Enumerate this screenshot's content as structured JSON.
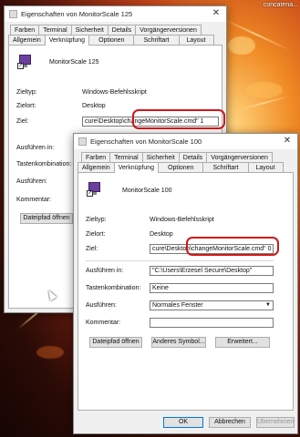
{
  "background": {
    "corner_text": "concatena..."
  },
  "win125": {
    "title": "Eigenschaften von MonitorScale 125",
    "tabs_row1": [
      "Farben",
      "Terminal",
      "Sicherheit",
      "Details",
      "Vorgängerversionen"
    ],
    "tabs_row2": [
      "Allgemein",
      "Verknüpfung",
      "Optionen",
      "Schriftart",
      "Layout"
    ],
    "name": "MonitorScale 125",
    "zieltyp_label": "Zieltyp:",
    "zieltyp_value": "Windows-Befehlsskript",
    "zielort_label": "Zielort:",
    "zielort_value": "Desktop",
    "ziel_label": "Ziel:",
    "ziel_value": "cure\\Desktop\\changeMonitorScale.cmd\" 1",
    "ausfuehren_in_label": "Ausführen in:",
    "tastenkombination_label": "Tastenkombination:",
    "ausfuehren_label": "Ausführen:",
    "kommentar_label": "Kommentar:",
    "dateipfad_button": "Dateipfad öffnen"
  },
  "win100": {
    "title": "Eigenschaften von MonitorScale 100",
    "tabs_row1": [
      "Farben",
      "Terminal",
      "Sicherheit",
      "Details",
      "Vorgängerversionen"
    ],
    "tabs_row2": [
      "Allgemein",
      "Verknüpfung",
      "Optionen",
      "Schriftart",
      "Layout"
    ],
    "name": "MonitorScale 100",
    "zieltyp_label": "Zieltyp:",
    "zieltyp_value": "Windows-Befehlsskript",
    "zielort_label": "Zielort:",
    "zielort_value": "Desktop",
    "ziel_label": "Ziel:",
    "ziel_value": "cure\\Desktop\\changeMonitorScale.cmd\" 0",
    "ausfuehren_in_label": "Ausführen in:",
    "ausfuehren_in_value": "\"C:\\Users\\Erzesel Secure\\Desktop\"",
    "tastenkombination_label": "Tastenkombination:",
    "tastenkombination_value": "Keine",
    "ausfuehren_label": "Ausführen:",
    "ausfuehren_value": "Normales Fenster",
    "kommentar_label": "Kommentar:",
    "kommentar_value": "",
    "dateipfad_button": "Dateipfad öffnen",
    "anderes_symbol_button": "Anderes Symbol...",
    "erweitert_button": "Erweitert...",
    "ok_button": "OK",
    "abbrechen_button": "Abbrechen",
    "uebernehmen_button": "Übernehmen"
  },
  "icons": {
    "close": "close-icon",
    "app": "monitor-shortcut-icon",
    "dropdown": "chevron-down-icon"
  }
}
